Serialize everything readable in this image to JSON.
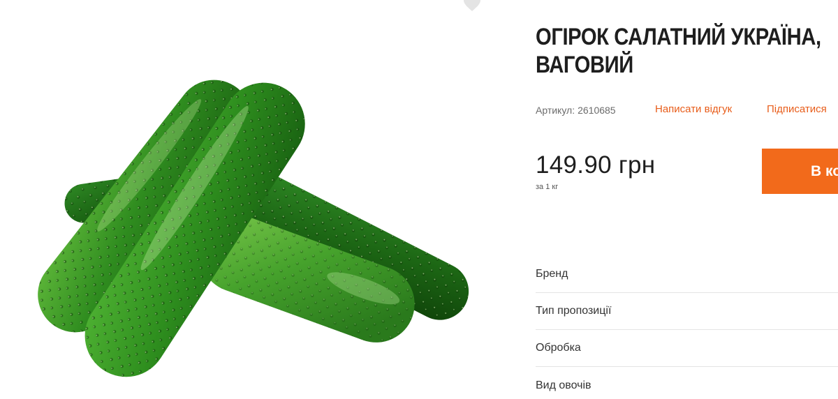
{
  "product": {
    "title_line1": "ОГІРОК САЛАТНИЙ УКРАЇНА,",
    "title_line2": "ВАГОВИЙ",
    "sku_label": "Артикул:",
    "sku_value": "2610685",
    "review_link": "Написати відгук",
    "subscribe_link": "Підписатися",
    "price": "149.90 грн",
    "price_unit": "за 1 кг",
    "cart_button": "В кошик"
  },
  "attributes": [
    {
      "label": "Бренд"
    },
    {
      "label": "Тип пропозиції"
    },
    {
      "label": "Обробка"
    },
    {
      "label": "Вид овочів"
    }
  ],
  "icons": {
    "favorite": "heart-icon"
  },
  "colors": {
    "accent": "#f26a1b",
    "link": "#e85d1a",
    "title": "#1e1e1e"
  }
}
